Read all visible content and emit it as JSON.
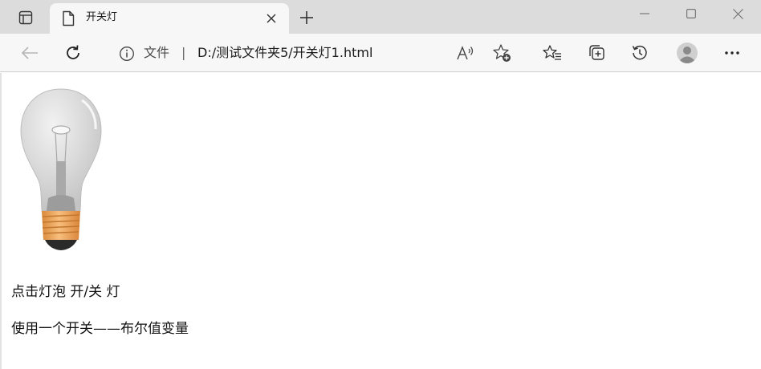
{
  "tab": {
    "title": "开关灯"
  },
  "address_bar": {
    "scheme_label": "文件",
    "separator": "|",
    "url": "D:/测试文件夹5/开关灯1.html"
  },
  "page": {
    "caption": "点击灯泡 开/关 灯",
    "subcaption": "使用一个开关——布尔值变量"
  },
  "icons": {
    "tab_actions": "tab-actions-icon",
    "favicon": "document-icon",
    "close_tab": "close-icon",
    "new_tab": "plus-icon",
    "minimize": "minimize-icon",
    "maximize": "maximize-icon",
    "close_window": "close-icon",
    "back": "back-arrow-icon",
    "refresh": "refresh-icon",
    "info": "info-icon",
    "read_aloud": "read-aloud-icon",
    "add_favorite": "star-plus-icon",
    "favorites": "favorites-icon",
    "collections": "collections-icon",
    "history": "history-icon",
    "profile": "avatar-icon",
    "more": "more-icon"
  },
  "colors": {
    "tabstrip_bg": "#dcdcdc",
    "toolbar_bg": "#f7f7f7",
    "bulb_glass": "#d9d9d9",
    "bulb_base": "#f2a65a"
  }
}
